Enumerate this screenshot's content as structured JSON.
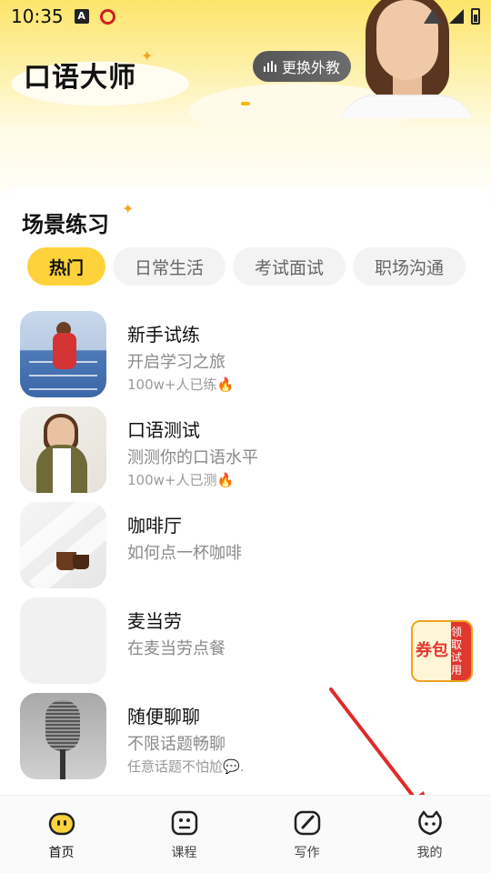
{
  "status_bar": {
    "time": "10:35"
  },
  "header": {
    "app_title": "口语大师",
    "switch_teacher_label": "更换外教"
  },
  "section": {
    "title": "场景练习",
    "tabs": [
      {
        "label": "热门",
        "active": true
      },
      {
        "label": "日常生活",
        "active": false
      },
      {
        "label": "考试面试",
        "active": false
      },
      {
        "label": "职场沟通",
        "active": false
      }
    ]
  },
  "scenes": [
    {
      "title": "新手试练",
      "subtitle": "开启学习之旅",
      "meta": "100w+人已练"
    },
    {
      "title": "口语测试",
      "subtitle": "测测你的口语水平",
      "meta": "100w+人已测"
    },
    {
      "title": "咖啡厅",
      "subtitle": "如何点一杯咖啡",
      "meta": ""
    },
    {
      "title": "麦当劳",
      "subtitle": "在麦当劳点餐",
      "meta": ""
    },
    {
      "title": "随便聊聊",
      "subtitle": "不限话题畅聊",
      "meta": "任意话题不怕尬💬."
    }
  ],
  "coupon": {
    "big": "券包",
    "small": "领取试用"
  },
  "bottom_nav": [
    {
      "label": "首页",
      "icon": "home-face-icon",
      "active": true
    },
    {
      "label": "课程",
      "icon": "course-icon",
      "active": false
    },
    {
      "label": "写作",
      "icon": "write-icon",
      "active": false
    },
    {
      "label": "我的",
      "icon": "profile-cat-icon",
      "active": false
    }
  ],
  "colors": {
    "accent": "#fdd23a",
    "annotation_arrow": "#e02a2a"
  }
}
